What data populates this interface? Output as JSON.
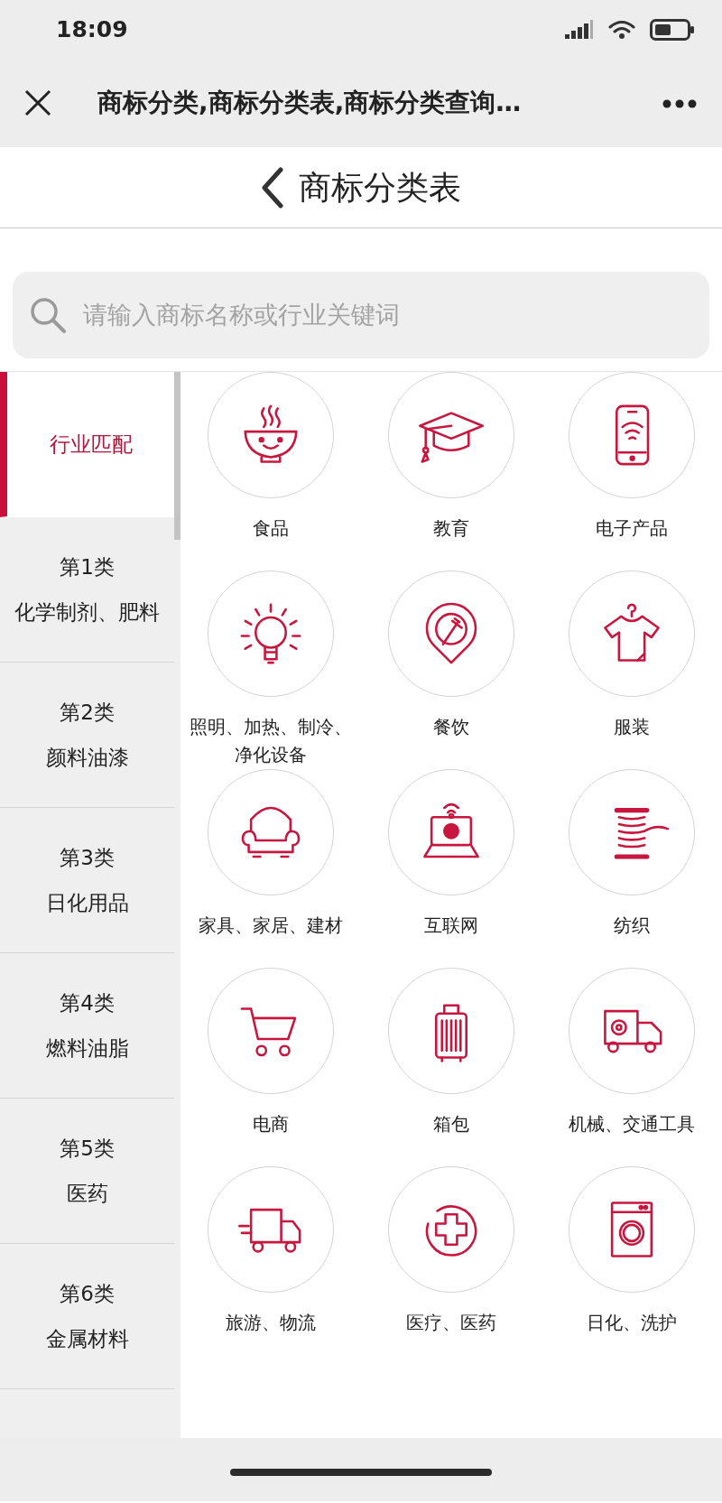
{
  "status_bar": {
    "time": "18:09"
  },
  "browser_bar": {
    "title": "商标分类,商标分类表,商标分类查询…"
  },
  "page_header": {
    "title": "商标分类表"
  },
  "search": {
    "placeholder": "请输入商标名称或行业关键词"
  },
  "sidebar": {
    "items": [
      {
        "lines": [
          "行业匹配"
        ],
        "selected": true
      },
      {
        "lines": [
          "第1类",
          "化学制剂、肥料"
        ],
        "selected": false
      },
      {
        "lines": [
          "第2类",
          "颜料油漆"
        ],
        "selected": false
      },
      {
        "lines": [
          "第3类",
          "日化用品"
        ],
        "selected": false
      },
      {
        "lines": [
          "第4类",
          "燃料油脂"
        ],
        "selected": false
      },
      {
        "lines": [
          "第5类",
          "医药"
        ],
        "selected": false
      },
      {
        "lines": [
          "第6类",
          "金属材料"
        ],
        "selected": false
      }
    ]
  },
  "categories": [
    {
      "label": "食品"
    },
    {
      "label": "教育"
    },
    {
      "label": "电子产品"
    },
    {
      "label": "照明、加热、制冷、净化设备"
    },
    {
      "label": "餐饮"
    },
    {
      "label": "服装"
    },
    {
      "label": "家具、家居、建材"
    },
    {
      "label": "互联网"
    },
    {
      "label": "纺织"
    },
    {
      "label": "电商"
    },
    {
      "label": "箱包"
    },
    {
      "label": "机械、交通工具"
    },
    {
      "label": "旅游、物流"
    },
    {
      "label": "医疗、医药"
    },
    {
      "label": "日化、洗护"
    }
  ]
}
